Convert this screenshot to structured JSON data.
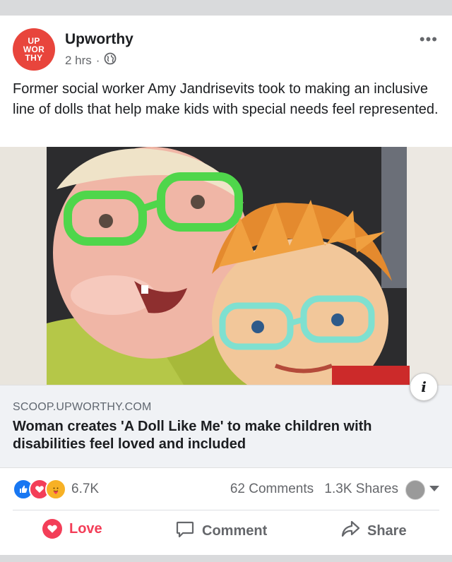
{
  "post": {
    "page_name": "Upworthy",
    "avatar_lines": [
      "UP",
      "WOR",
      "THY"
    ],
    "time": "2 hrs",
    "separator": "·",
    "more_label": "•••",
    "caption": "Former social worker Amy Jandrisevits took to making an inclusive line of dolls that help make kids with special needs feel represented."
  },
  "link": {
    "domain": "SCOOP.UPWORTHY.COM",
    "title": "Woman creates 'A Doll Like Me' to make children with disabilities feel loved and included",
    "info_label": "i"
  },
  "stats": {
    "reaction_count": "6.7K",
    "comments": "62 Comments",
    "shares": "1.3K Shares"
  },
  "actions": {
    "love": "Love",
    "comment": "Comment",
    "share": "Share"
  },
  "colors": {
    "brand": "#e8453c",
    "like": "#1877f2",
    "love": "#f33e58",
    "care": "#f7b125",
    "muted": "#65676b"
  }
}
